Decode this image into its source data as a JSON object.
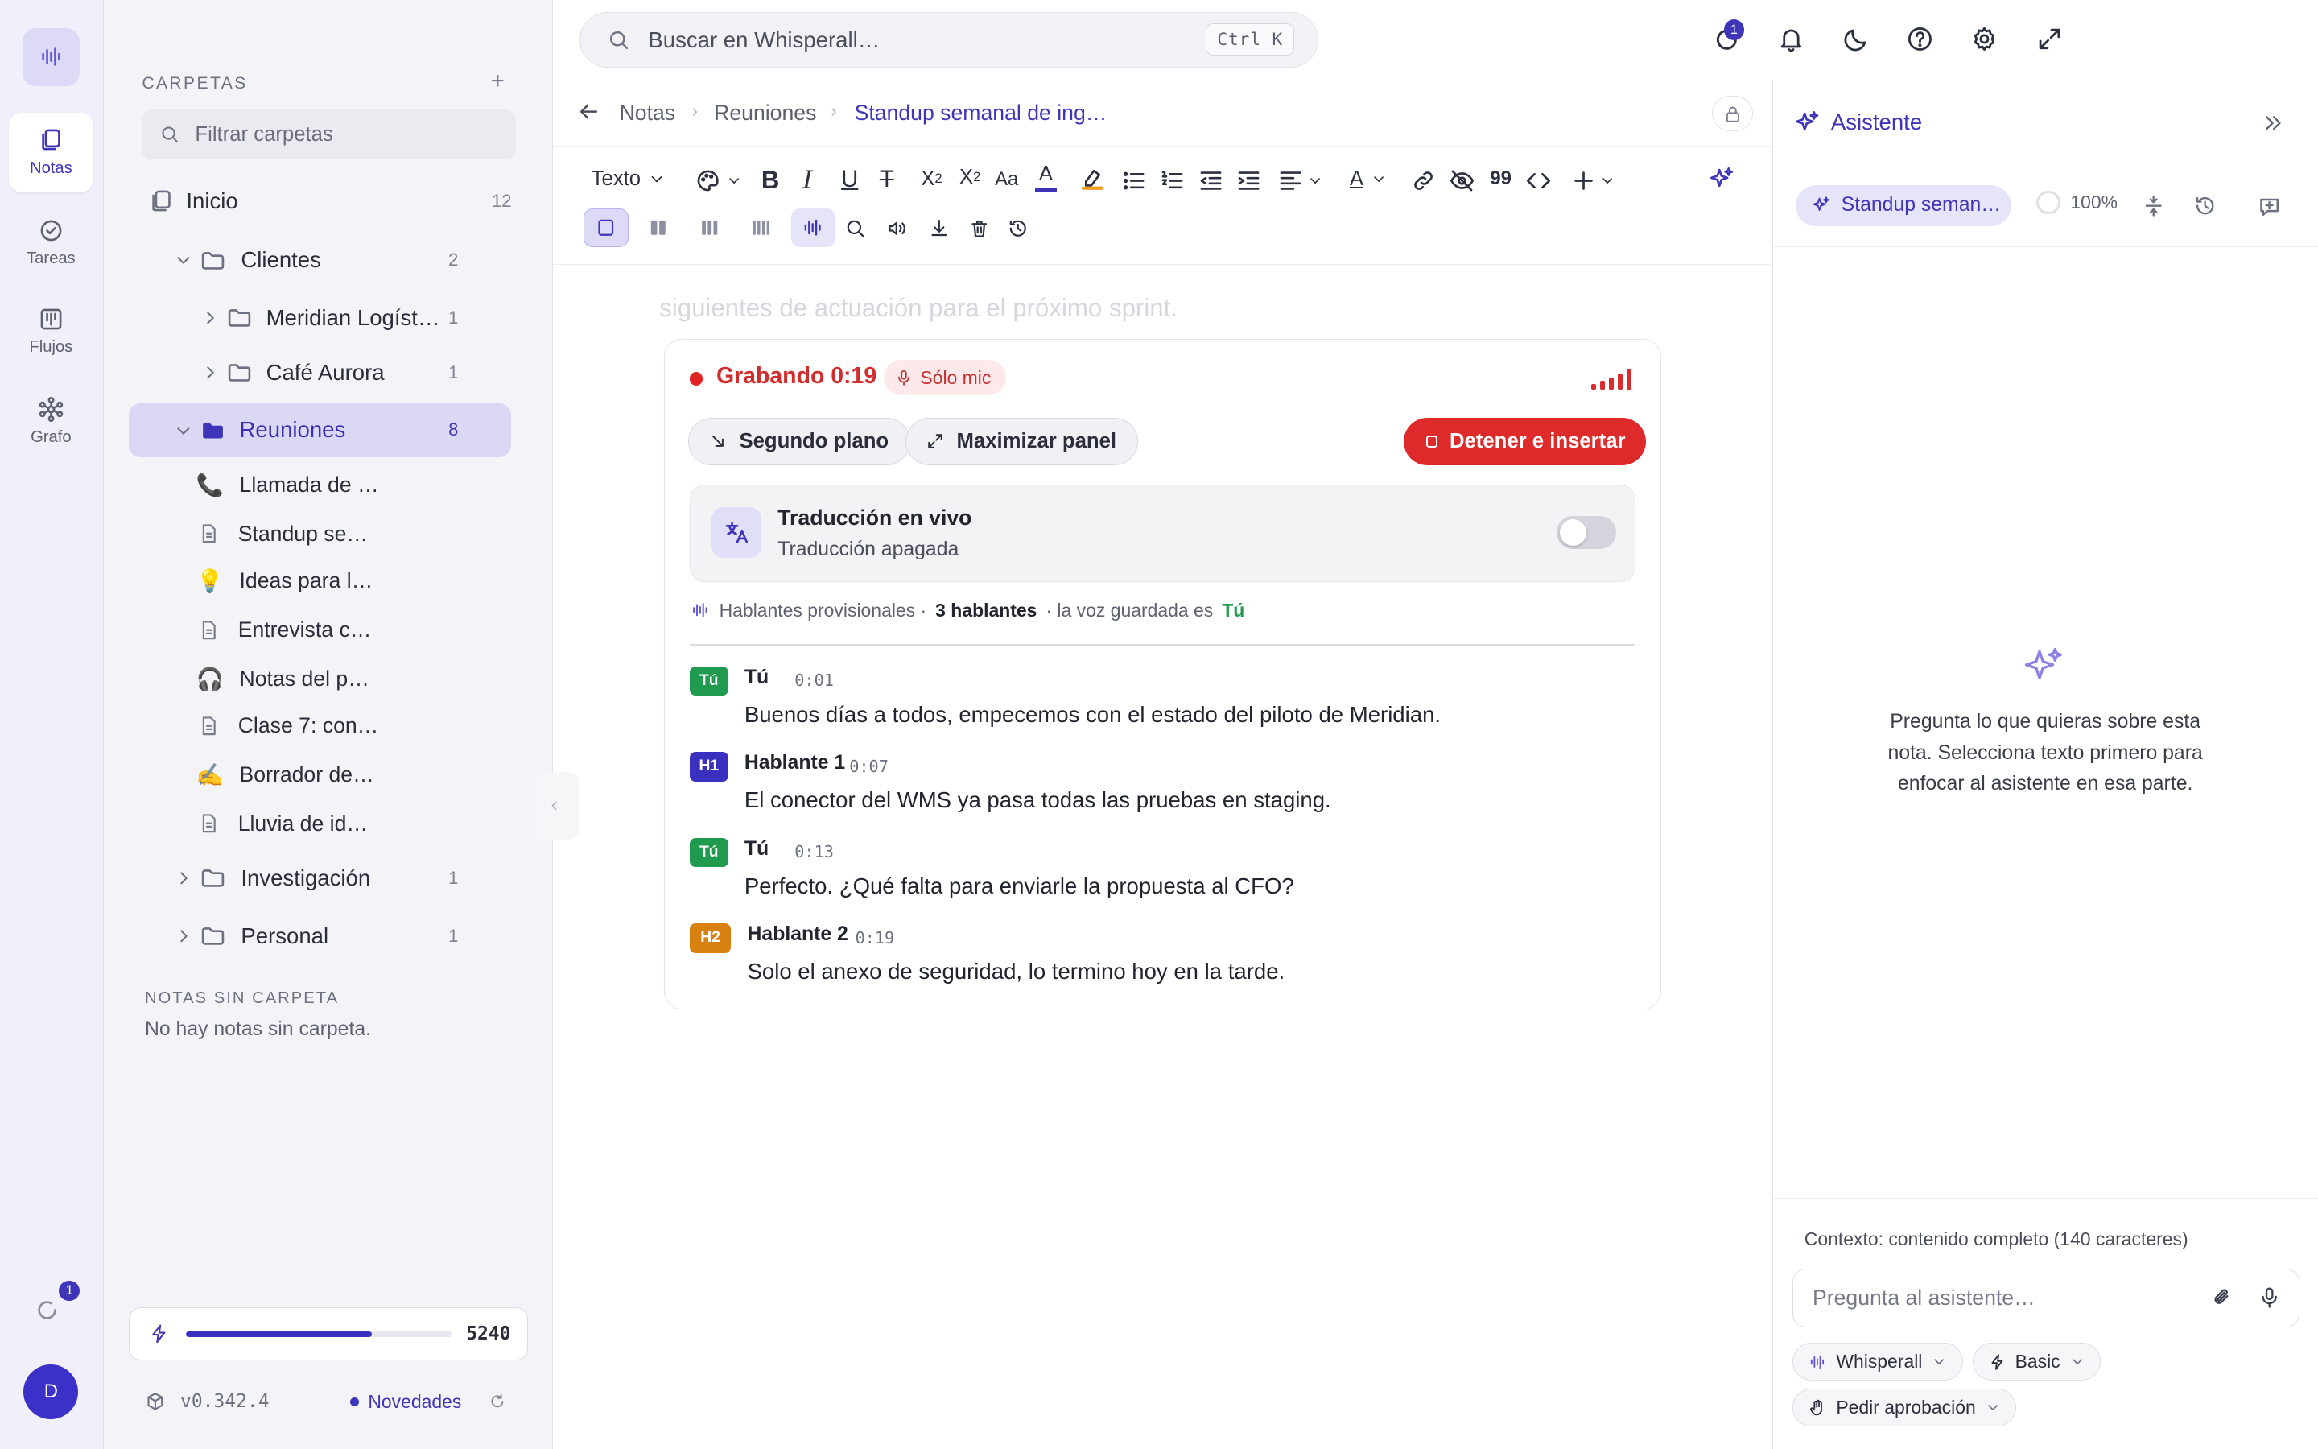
{
  "rail": {
    "items": [
      {
        "label": "Notas",
        "icon": "notes-icon"
      },
      {
        "label": "Tareas",
        "icon": "tasks-icon"
      },
      {
        "label": "Flujos",
        "icon": "flows-icon"
      },
      {
        "label": "Grafo",
        "icon": "graph-icon"
      }
    ],
    "sync_badge": "1",
    "avatar_initial": "D"
  },
  "sidebar": {
    "heading": "CARPETAS",
    "add_label": "+",
    "filter_placeholder": "Filtrar carpetas",
    "home": {
      "label": "Inicio",
      "count": "12"
    },
    "folders": {
      "clientes": {
        "label": "Clientes",
        "count": "2"
      },
      "meridian": {
        "label": "Meridian Logística",
        "count": "1"
      },
      "cafe": {
        "label": "Café Aurora",
        "count": "1"
      },
      "reuniones": {
        "label": "Reuniones",
        "count": "8"
      },
      "investigacion": {
        "label": "Investigación",
        "count": "1"
      },
      "personal": {
        "label": "Personal",
        "count": "1"
      }
    },
    "notes": [
      {
        "label": "Llamada de …",
        "icon": "📞"
      },
      {
        "label": "Standup se…",
        "icon": "doc"
      },
      {
        "label": "Ideas para l…",
        "icon": "💡"
      },
      {
        "label": "Entrevista c…",
        "icon": "doc"
      },
      {
        "label": "Notas del p…",
        "icon": "🎧"
      },
      {
        "label": "Clase 7: con…",
        "icon": "doc"
      },
      {
        "label": "Borrador de…",
        "icon": "✍️"
      },
      {
        "label": "Lluvia de id…",
        "icon": "doc"
      }
    ],
    "no_folder_heading": "NOTAS SIN CARPETA",
    "no_folder_text": "No hay notas sin carpeta.",
    "usage": {
      "value": "5240",
      "fill_fraction": 0.7
    },
    "version": "v0.342.4",
    "news_label": "Novedades"
  },
  "topbar": {
    "search_placeholder": "Buscar en Whisperall…",
    "shortcut": "Ctrl K",
    "badge": "1"
  },
  "editor": {
    "breadcrumb": [
      "Notas",
      "Reuniones",
      "Standup semanal de ing…"
    ],
    "toolbar_text_style": "Texto",
    "ghost_text": "siguientes de actuación para el próximo sprint.",
    "recording": {
      "status": "Grabando 0:19",
      "source": "Sólo mic",
      "background_label": "Segundo plano",
      "maximize_label": "Maximizar panel",
      "stop_label": "Detener e insertar",
      "translation_title": "Traducción en vivo",
      "translation_status": "Traducción apagada",
      "speakers_prefix": "Hablantes provisionales ·",
      "speakers_count": "3 hablantes",
      "speakers_suffix": "· la voz guardada es",
      "speakers_you": "Tú",
      "lines": [
        {
          "tag": "Tú",
          "speaker": "Tú",
          "time": "0:01",
          "text": "Buenos días a todos, empecemos con el estado del piloto de Meridian.",
          "color": "#1f9a4e"
        },
        {
          "tag": "H1",
          "speaker": "Hablante 1",
          "time": "0:07",
          "text": "El conector del WMS ya pasa todas las pruebas en staging.",
          "color": "#3a30c0"
        },
        {
          "tag": "Tú",
          "speaker": "Tú",
          "time": "0:13",
          "text": "Perfecto. ¿Qué falta para enviarle la propuesta al CFO?",
          "color": "#1f9a4e"
        },
        {
          "tag": "H2",
          "speaker": "Hablante 2",
          "time": "0:19",
          "text": "Solo el anexo de seguridad, lo termino hoy en la tarde.",
          "color": "#d98110"
        }
      ]
    }
  },
  "assistant": {
    "title": "Asistente",
    "context_chip": "Standup seman…",
    "percent": "100%",
    "empty_text": "Pregunta lo que quieras sobre esta nota. Selecciona texto primero para enfocar al asistente en esa parte.",
    "context_info": "Contexto: contenido completo (140 caracteres)",
    "input_placeholder": "Pregunta al asistente…",
    "model_label": "Whisperall",
    "tier_label": "Basic",
    "approval_label": "Pedir aprobación"
  },
  "colors": {
    "accent": "#3f35b8",
    "record": "#de2a2a",
    "you": "#1f9a4e",
    "speaker1": "#3a30c0",
    "speaker2": "#d98110"
  }
}
